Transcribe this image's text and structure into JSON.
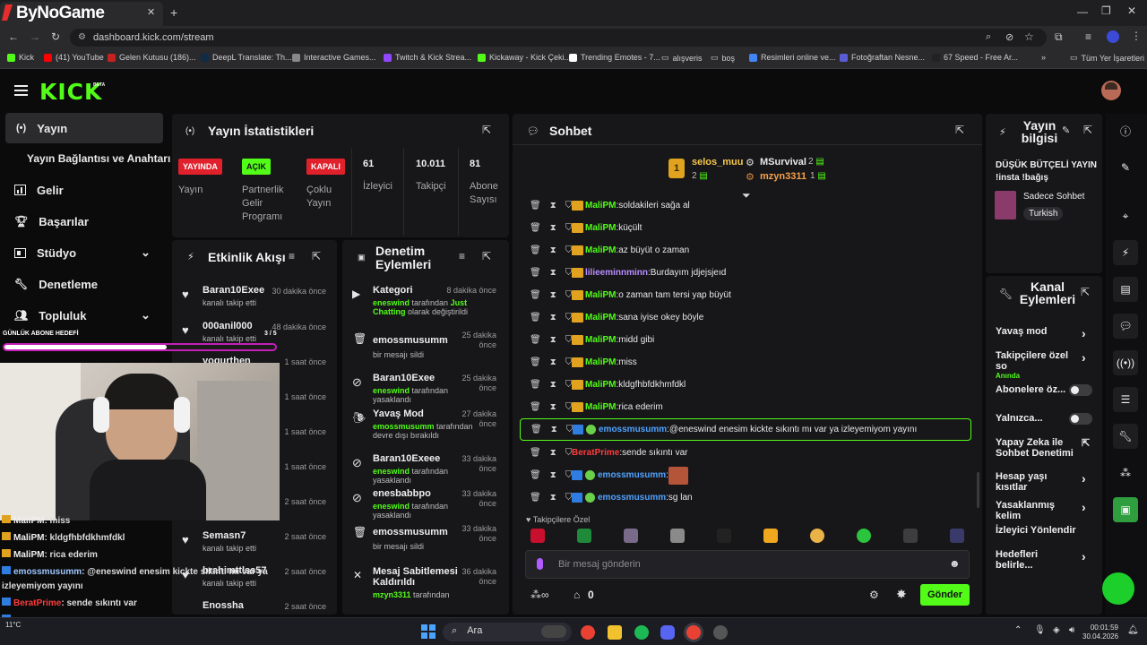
{
  "browser": {
    "tab_title": "ByNoGame",
    "url": "dashboard.kick.com/stream",
    "bookmarks": [
      "Kick",
      "(41) YouTube",
      "Gelen Kutusu (186)...",
      "DeepL Translate: Th...",
      "Interactive Games...",
      "Twitch & Kick Strea...",
      "Kickaway - Kick Çeki...",
      "Trending Emotes - 7...",
      "alışveris",
      "boş",
      "Resimleri online ve...",
      "Fotoğraftan Nesne...",
      "67 Speed - Free Ar...",
      "Tüm Yer İşaretleri"
    ],
    "bookmark_colors": [
      "#53fc18",
      "#ff0000",
      "#c5221f",
      "#0f2b46",
      "#888888",
      "#9146ff",
      "#53fc18",
      "#ffffff",
      "#cccccc",
      "#cccccc",
      "#4285f4",
      "#5b5bd6",
      "#222222",
      "#cccccc"
    ]
  },
  "app": {
    "logo": "KICK",
    "logo_beta": "BETA",
    "accent": "#53fc18"
  },
  "sidebar": {
    "items": [
      {
        "label": "Yayın",
        "icon": "broadcast-icon"
      },
      {
        "label": "Yayın Bağlantısı ve Anahtarı",
        "icon": ""
      },
      {
        "label": "Gelir",
        "icon": "chart-icon"
      },
      {
        "label": "Başarılar",
        "icon": "trophy-icon"
      },
      {
        "label": "Stüdyo",
        "icon": "studio-icon"
      },
      {
        "label": "Denetleme",
        "icon": "wrench-icon"
      },
      {
        "label": "Topluluk",
        "icon": "people-icon"
      }
    ]
  },
  "stats": {
    "title": "Yayın İstatistikleri",
    "items": [
      {
        "badge": "YAYINDA",
        "label": "Yayın"
      },
      {
        "badge": "AÇIK",
        "label": "Partnerlik Gelir Programı"
      },
      {
        "badge": "KAPALI",
        "label": "Çoklu Yayın"
      },
      {
        "value": "61",
        "label": "İzleyici"
      },
      {
        "value": "10.011",
        "label": "Takipçi"
      },
      {
        "value": "81",
        "label": "Abone Sayısı"
      }
    ]
  },
  "activity": {
    "title": "Etkinlik Akışı",
    "events": [
      {
        "name": "Baran10Exee",
        "sub": "kanalı takip etti",
        "time": "30 dakika önce"
      },
      {
        "name": "000anil000",
        "sub": "kanalı takip etti",
        "time": "48 dakika önce"
      },
      {
        "name": "yogurthen",
        "sub": "",
        "time": "1 saat önce"
      },
      {
        "name": "",
        "sub": "",
        "time": "1 saat önce"
      },
      {
        "name": "",
        "sub": "",
        "time": "1 saat önce"
      },
      {
        "name": "",
        "sub": "",
        "time": "1 saat önce"
      },
      {
        "name": "",
        "sub": "",
        "time": "2 saat önce"
      },
      {
        "name": "Semasn7",
        "sub": "kanalı takip etti",
        "time": "2 saat önce"
      },
      {
        "name": "brahimttlss57",
        "sub": "kanalı takip etti",
        "time": "2 saat önce"
      },
      {
        "name": "Enossha",
        "sub": "",
        "time": "2 saat önce"
      }
    ]
  },
  "moderation": {
    "title": "Denetim Eylemleri",
    "items": [
      {
        "name": "Kategori",
        "sub1": "eneswind",
        "sub2": " tarafından ",
        "sub3": "Just Chatting",
        "sub4": " olarak değiştirildi",
        "time": "8 dakika önce"
      },
      {
        "name": "emossmusumm",
        "sub1": "",
        "sub2": "bir mesajı sildi",
        "sub3": "",
        "sub4": "",
        "time": "25 dakika önce"
      },
      {
        "name": "Baran10Exee",
        "sub1": "eneswind",
        "sub2": " tarafından yasaklandı",
        "sub3": "",
        "sub4": "",
        "time": "25 dakika önce"
      },
      {
        "name": "Yavaş Mod",
        "sub1": "emossmusumm",
        "sub2": " tarafından devre dışı bırakıldı",
        "sub3": "",
        "sub4": "",
        "time": "27 dakika önce"
      },
      {
        "name": "Baran10Exeee",
        "sub1": "eneswind",
        "sub2": " tarafından yasaklandı",
        "sub3": "",
        "sub4": "",
        "time": "33 dakika önce"
      },
      {
        "name": "enesbabbpo",
        "sub1": "eneswind",
        "sub2": " tarafından yasaklandı",
        "sub3": "",
        "sub4": "",
        "time": "33 dakika önce"
      },
      {
        "name": "emossmusumm",
        "sub1": "",
        "sub2": "bir mesajı sildi",
        "sub3": "",
        "sub4": "",
        "time": "33 dakika önce"
      },
      {
        "name": "Mesaj Sabitlemesi Kaldırıldı",
        "sub1": "mzyn3311",
        "sub2": " tarafından",
        "sub3": "",
        "sub4": "",
        "time": "36 dakika önce"
      }
    ]
  },
  "chat": {
    "title": "Sohbet",
    "top": [
      {
        "name": "selos_muu",
        "count": "2",
        "rank": "1"
      },
      {
        "name": "MSurvival",
        "count": "2"
      },
      {
        "name": "mzyn3311",
        "count": "1"
      }
    ],
    "messages": [
      {
        "user": "MaliPM",
        "text": "soldakileri sağa al",
        "color": "#53fc18"
      },
      {
        "user": "MaliPM",
        "text": "küçült",
        "color": "#53fc18"
      },
      {
        "user": "MaliPM",
        "text": "az büyüt o zaman",
        "color": "#53fc18"
      },
      {
        "user": "lilieeminnminn",
        "text": "Burdayım jdjejsjeıd",
        "color": "#b98cff"
      },
      {
        "user": "MaliPM",
        "text": "o zaman tam tersi yap büyüt",
        "color": "#53fc18"
      },
      {
        "user": "MaliPM",
        "text": "sana iyise okey böyle",
        "color": "#53fc18"
      },
      {
        "user": "MaliPM",
        "text": "midd gibi",
        "color": "#53fc18"
      },
      {
        "user": "MaliPM",
        "text": "miss",
        "color": "#53fc18"
      },
      {
        "user": "MaliPM",
        "text": "kldgfhbfdkhmfdkl",
        "color": "#53fc18"
      },
      {
        "user": "MaliPM",
        "text": "rica ederim",
        "color": "#53fc18"
      },
      {
        "user": "emossmusumm",
        "text": "@eneswind enesim kickte sıkıntı mı var ya izleyemiyom yayını",
        "color": "#4fa3ff"
      },
      {
        "user": "BeratPrime",
        "text": "sende sıkıntı var",
        "color": "#ff3b3b"
      },
      {
        "user": "emossmusumm",
        "text": "",
        "color": "#4fa3ff"
      },
      {
        "user": "emossmusumm",
        "text": "sg lan",
        "color": "#4fa3ff"
      }
    ],
    "followers_only": "Takipçilere Özel",
    "input_placeholder": "Bir mesaj gönderin",
    "points": "0",
    "send_label": "Gönder"
  },
  "stream_info": {
    "title": "Yayın bilgisi",
    "stream_title": "DÜŞÜK BÜTÇELİ YAYIN !insta !bağış",
    "category": "Sadece Sohbet",
    "language": "Turkish"
  },
  "channel_actions": {
    "title": "Kanal Eylemleri",
    "items": [
      {
        "label": "Yavaş mod",
        "sub": "",
        "type": "chevron"
      },
      {
        "label": "Takipçilere özel so",
        "sub": "Anında",
        "type": "chevron"
      },
      {
        "label": "Abonelere öz...",
        "sub": "",
        "type": "toggle"
      },
      {
        "label": "Yalnızca...",
        "sub": "",
        "type": "toggle"
      },
      {
        "label": "Yapay Zeka ile Sohbet Denetimi",
        "sub": "",
        "type": "link"
      },
      {
        "label": "Hesap yaşı kısıtlar",
        "sub": "",
        "type": "chevron"
      },
      {
        "label": "Yasaklanmış kelim",
        "sub": "",
        "type": "chevron"
      },
      {
        "label": "İzleyici Yönlendir",
        "sub": "",
        "type": "none"
      },
      {
        "label": "Hedefleri belirle...",
        "sub": "",
        "type": "chevron"
      }
    ]
  },
  "overlay": {
    "goal_label": "GÜNLÜK ABONE HEDEFİ",
    "goal_progress": "3 / 5",
    "goal_fraction": 0.6,
    "chat": [
      {
        "user": "MaliPM",
        "text": ": miss"
      },
      {
        "user": "MaliPM",
        "text": ": kldgfhbfdkhmfdkl"
      },
      {
        "user": "MaliPM",
        "text": ": rica ederim"
      },
      {
        "user": "emossmusumm",
        "text": ": @eneswind enesim kickte sıkıntı mı var ya izleyemiyom yayını"
      },
      {
        "user": "BeratPrime",
        "text": ": sende sıkıntı var"
      },
      {
        "user": "emossmusumm",
        "text": " :"
      },
      {
        "user": "emossmusumm",
        "text": ": sg lan"
      }
    ],
    "temp": "11°C"
  },
  "taskbar": {
    "search": "Ara",
    "time": "00:01:59",
    "date": "30.04.2026"
  }
}
